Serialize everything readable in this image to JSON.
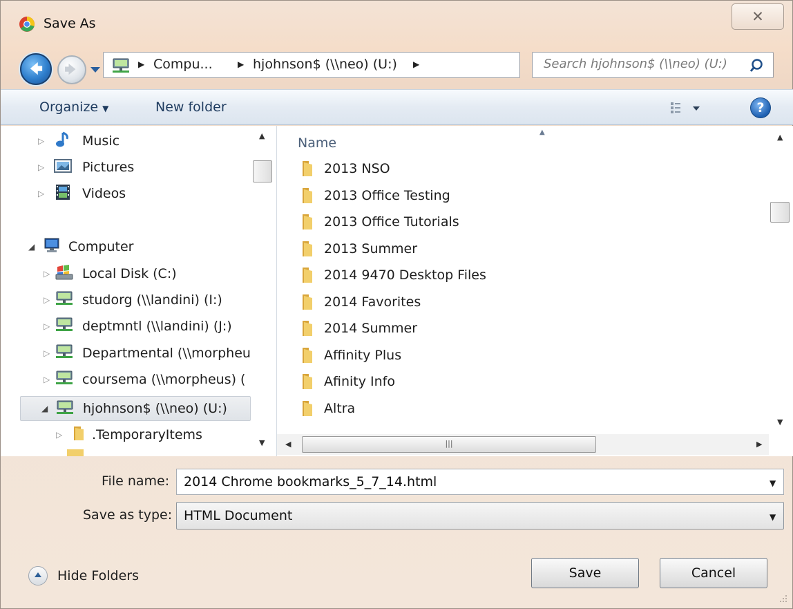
{
  "window": {
    "title": "Save As",
    "close_glyph": "✕"
  },
  "address": {
    "crumbs": [
      "Compu...",
      "hjohnson$ (\\\\neo) (U:)"
    ],
    "search_placeholder": "Search hjohnson$ (\\\\neo) (U:)"
  },
  "toolbar": {
    "organize_label": "Organize",
    "new_folder_label": "New folder"
  },
  "nav_tree": [
    {
      "label": "Music",
      "icon": "music-icon"
    },
    {
      "label": "Pictures",
      "icon": "pictures-icon"
    },
    {
      "label": "Videos",
      "icon": "videos-icon"
    },
    {
      "label": "Computer",
      "icon": "computer-icon"
    },
    {
      "label": "Local Disk (C:)",
      "icon": "local-disk-icon"
    },
    {
      "label": "studorg (\\\\landini) (I:)",
      "icon": "network-drive-icon"
    },
    {
      "label": "deptmntl (\\\\landini) (J:)",
      "icon": "network-drive-icon"
    },
    {
      "label": "Departmental (\\\\morpheu",
      "icon": "network-drive-icon"
    },
    {
      "label": "coursema (\\\\morpheus) (",
      "icon": "network-drive-icon"
    },
    {
      "label": "hjohnson$ (\\\\neo) (U:)",
      "icon": "network-drive-icon"
    },
    {
      "label": ".TemporaryItems",
      "icon": "folder-icon"
    }
  ],
  "file_list": {
    "column_name": "Name",
    "items": [
      "2013 NSO",
      "2013 Office Testing",
      "2013 Office Tutorials",
      "2013 Summer",
      "2014 9470 Desktop Files",
      "2014 Favorites",
      "2014 Summer",
      "Affinity Plus",
      "Afinity Info",
      "Altra"
    ]
  },
  "form": {
    "file_name_label": "File name:",
    "file_name_value": "2014 Chrome bookmarks_5_7_14.html",
    "save_type_label": "Save as type:",
    "save_type_value": "HTML Document"
  },
  "footer": {
    "hide_folders_label": "Hide Folders",
    "save_label": "Save",
    "cancel_label": "Cancel"
  },
  "colors": {
    "link_text": "#1e3b5f",
    "selection": "#dfe3e8",
    "folder": "#e8b84a"
  }
}
